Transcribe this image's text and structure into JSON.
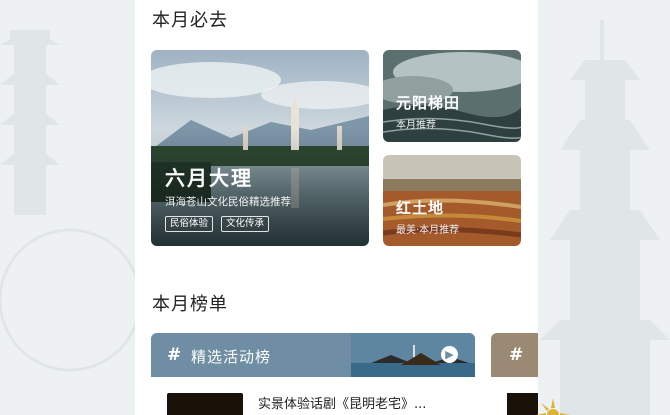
{
  "must_go": {
    "title": "本月必去",
    "featured": {
      "title": "六月大理",
      "subtitle": "洱海苍山文化民俗精选推荐",
      "tags": [
        "民俗体验",
        "文化传承"
      ]
    },
    "side_cards": [
      {
        "title": "元阳梯田",
        "subtitle": "本月推荐"
      },
      {
        "title": "红土地",
        "subtitle": "最美·本月推荐"
      }
    ]
  },
  "ranking": {
    "title": "本月榜单",
    "lists": [
      {
        "label": "精选活动榜",
        "hash": "#",
        "first_item": "实景体验话剧《昆明老宅》..."
      },
      {
        "hash": "#"
      }
    ]
  },
  "icons": {
    "hash": "hash-icon",
    "arrow": "chevron-right-icon"
  }
}
